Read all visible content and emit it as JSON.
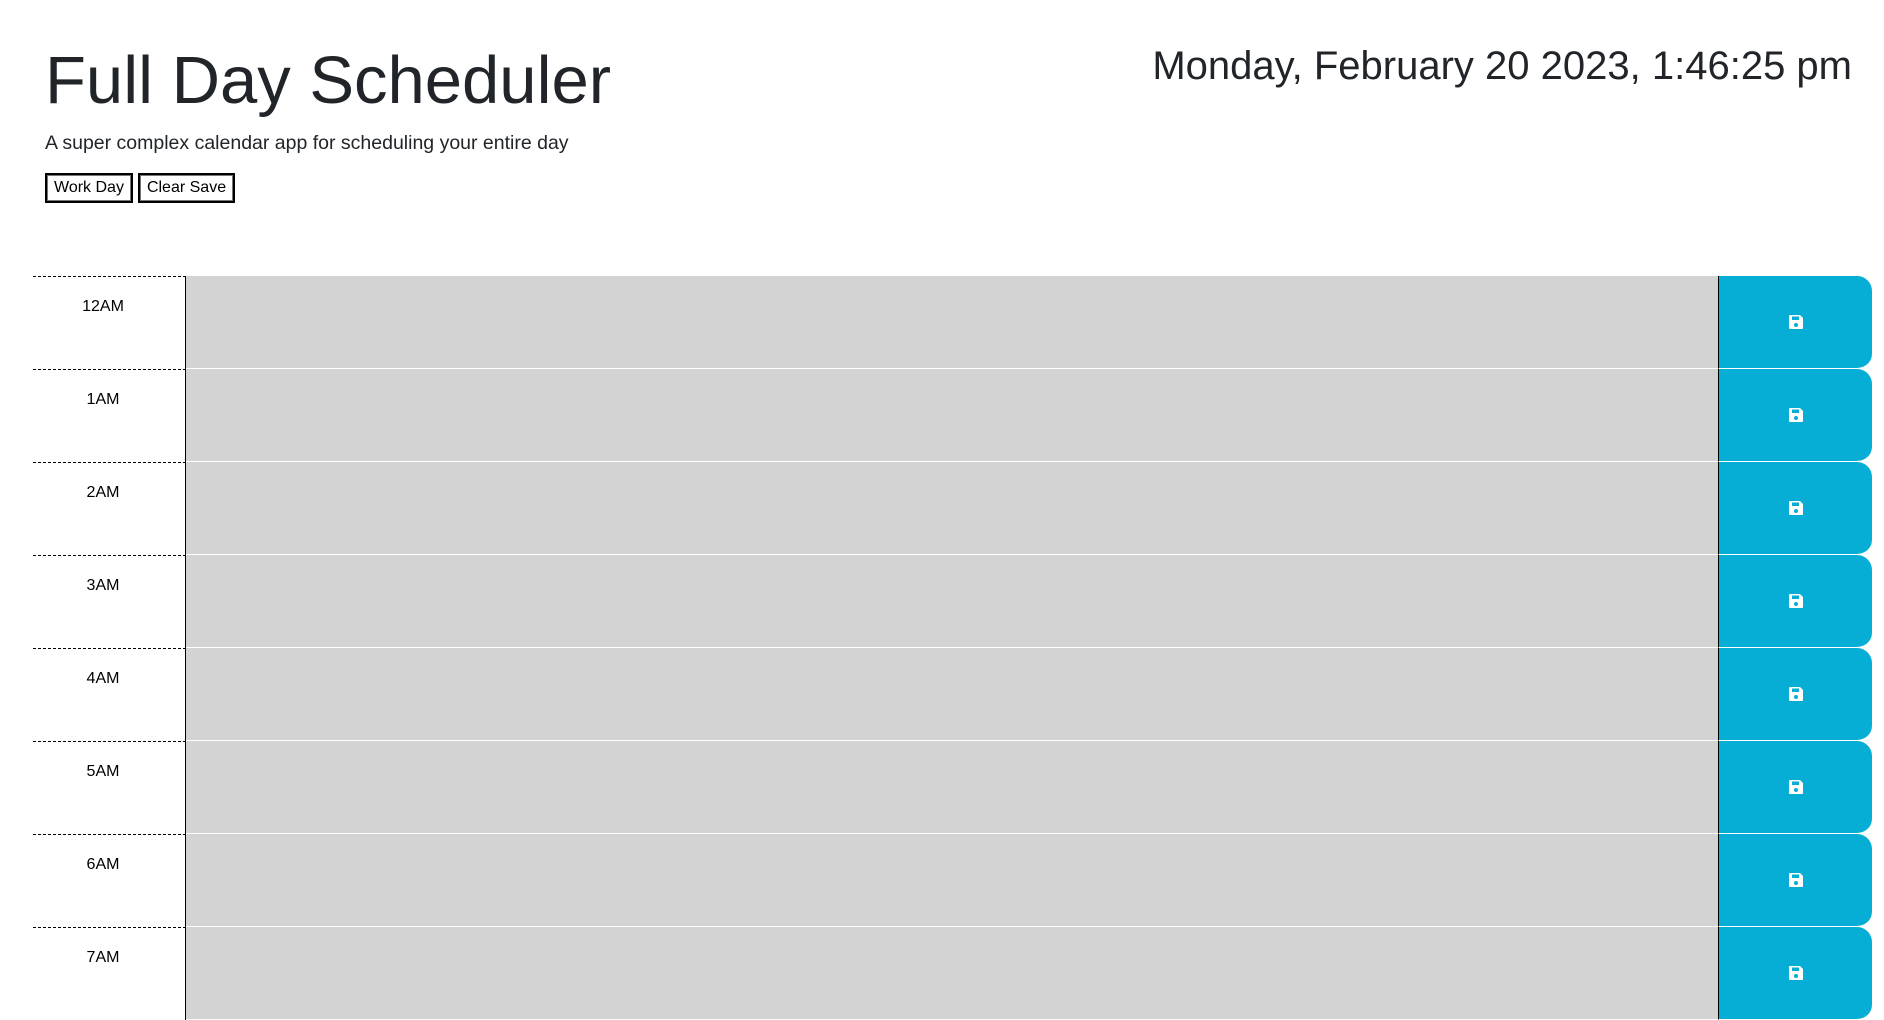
{
  "header": {
    "title": "Full Day Scheduler",
    "subtitle": "A super complex calendar app for scheduling your entire day",
    "datetime": "Monday, February 20 2023, 1:46:25 pm",
    "buttons": {
      "work_day": "Work Day",
      "clear_save": "Clear Save"
    }
  },
  "schedule": {
    "hours": [
      "12AM",
      "1AM",
      "2AM",
      "3AM",
      "4AM",
      "5AM",
      "6AM",
      "7AM"
    ],
    "save_icon": "floppy-disk-icon",
    "colors": {
      "past": "#d3d3d3",
      "save_button": "#06aed5",
      "save_icon": "#ffffff"
    }
  }
}
